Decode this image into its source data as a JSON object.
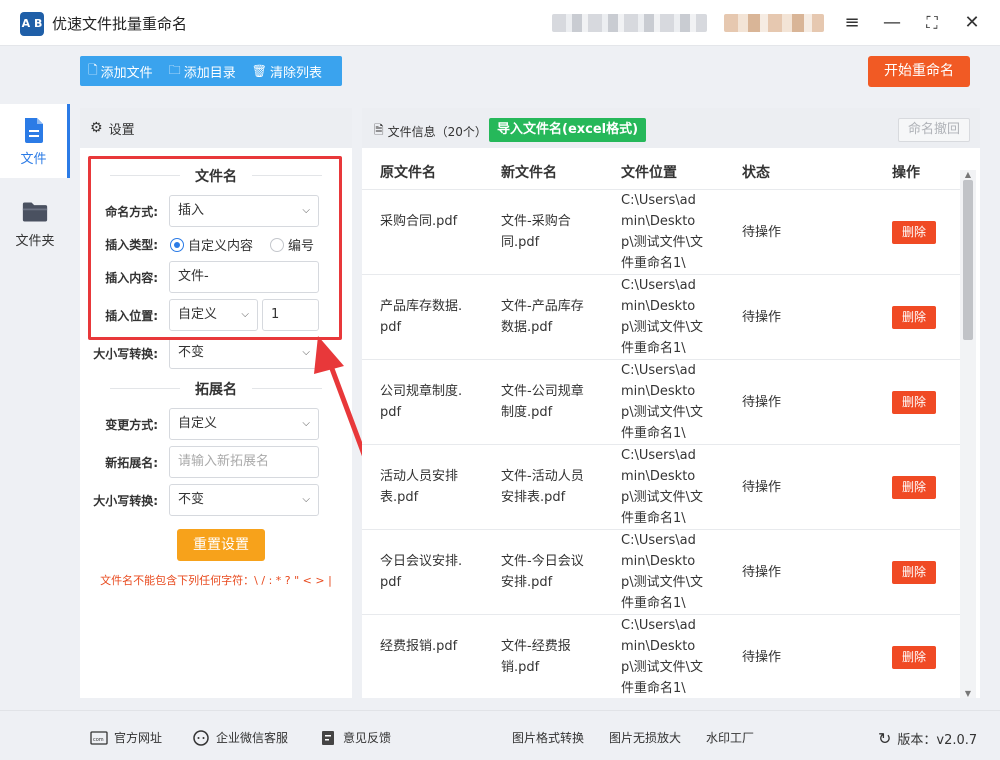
{
  "app": {
    "title": "优速文件批量重命名",
    "logo_text": "A B"
  },
  "window_controls": [
    "menu-icon",
    "minimize-icon",
    "maximize-icon",
    "close-icon"
  ],
  "nav": [
    {
      "label": "文件",
      "icon": "file-icon",
      "active": true
    },
    {
      "label": "文件夹",
      "icon": "folder-icon",
      "active": false
    }
  ],
  "toolbar": {
    "add_file": "添加文件",
    "add_dir": "添加目录",
    "clear_list": "清除列表",
    "start": "开始重命名"
  },
  "settings": {
    "header": "设置",
    "filename_section": "文件名",
    "naming_mode_label": "命名方式:",
    "naming_mode_value": "插入",
    "insert_type_label": "插入类型:",
    "insert_type_options": [
      "自定义内容",
      "编号"
    ],
    "insert_type_selected": "自定义内容",
    "insert_content_label": "插入内容:",
    "insert_content_value": "文件-",
    "insert_position_label": "插入位置:",
    "insert_position_value": "自定义",
    "insert_position_number": "1",
    "case_label": "大小写转换:",
    "case_value": "不变",
    "ext_section": "拓展名",
    "change_mode_label": "变更方式:",
    "change_mode_value": "自定义",
    "new_ext_label": "新拓展名:",
    "new_ext_placeholder": "请输入新拓展名",
    "ext_case_label": "大小写转换:",
    "ext_case_value": "不变",
    "reset": "重置设置",
    "warning": "文件名不能包含下列任何字符：\\ / : * ? \" < > |"
  },
  "filepanel": {
    "title": "文件信息（20个）",
    "import_btn": "导入文件名(excel格式)",
    "undo_btn": "命名撤回",
    "columns": [
      "原文件名",
      "新文件名",
      "文件位置",
      "状态",
      "操作"
    ],
    "rows": [
      {
        "orig": "采购合同.pdf",
        "new": "文件-采购合同.pdf",
        "path": "C:\\Users\\admin\\Desktop\\测试文件\\文件重命名1\\",
        "status": "待操作",
        "action": "删除"
      },
      {
        "orig": "产品库存数据.pdf",
        "new": "文件-产品库存数据.pdf",
        "path": "C:\\Users\\admin\\Desktop\\测试文件\\文件重命名1\\",
        "status": "待操作",
        "action": "删除"
      },
      {
        "orig": "公司规章制度.pdf",
        "new": "文件-公司规章制度.pdf",
        "path": "C:\\Users\\admin\\Desktop\\测试文件\\文件重命名1\\",
        "status": "待操作",
        "action": "删除"
      },
      {
        "orig": "活动人员安排表.pdf",
        "new": "文件-活动人员安排表.pdf",
        "path": "C:\\Users\\admin\\Desktop\\测试文件\\文件重命名1\\",
        "status": "待操作",
        "action": "删除"
      },
      {
        "orig": "今日会议安排.pdf",
        "new": "文件-今日会议安排.pdf",
        "path": "C:\\Users\\admin\\Desktop\\测试文件\\文件重命名1\\",
        "status": "待操作",
        "action": "删除"
      },
      {
        "orig": "经费报销.pdf",
        "new": "文件-经费报销.pdf",
        "path": "C:\\Users\\admin\\Desktop\\测试文件\\文件重命名1\\",
        "status": "待操作",
        "action": "删除"
      }
    ]
  },
  "footer": {
    "website": "官方网址",
    "wechat": "企业微信客服",
    "feedback": "意见反馈",
    "img_convert": "图片格式转换",
    "img_upscale": "图片无损放大",
    "watermark": "水印工厂",
    "version": "版本：v2.0.7"
  },
  "colors": {
    "accent": "#2b7be6",
    "toolbar": "#3aa3ee",
    "start": "#f15a24",
    "import": "#26b85a",
    "reset": "#f7a21b",
    "highlight": "#e8383a"
  }
}
